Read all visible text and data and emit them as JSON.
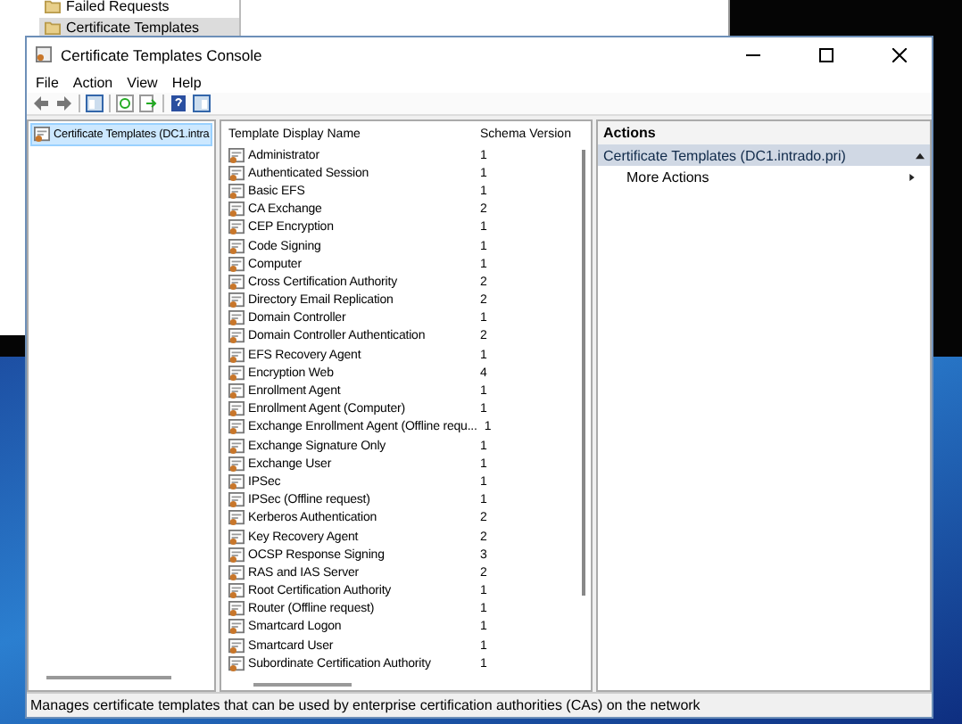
{
  "background_window": {
    "tree_items": [
      {
        "label": "Failed Requests",
        "selected": false
      },
      {
        "label": "Certificate Templates",
        "selected": true
      }
    ]
  },
  "window": {
    "title": "Certificate Templates Console"
  },
  "menu": [
    "File",
    "Action",
    "View",
    "Help"
  ],
  "tree": {
    "items": [
      {
        "label": "Certificate Templates (DC1.intra",
        "selected": true
      }
    ]
  },
  "table": {
    "columns": [
      "Template Display Name",
      "Schema Version"
    ],
    "rows": [
      {
        "name": "Administrator",
        "version": "1"
      },
      {
        "name": "Authenticated Session",
        "version": "1"
      },
      {
        "name": "Basic EFS",
        "version": "1"
      },
      {
        "name": "CA Exchange",
        "version": "2"
      },
      {
        "name": "CEP Encryption",
        "version": "1"
      },
      {
        "name": "Code Signing",
        "version": "1"
      },
      {
        "name": "Computer",
        "version": "1"
      },
      {
        "name": "Cross Certification Authority",
        "version": "2"
      },
      {
        "name": "Directory Email Replication",
        "version": "2"
      },
      {
        "name": "Domain Controller",
        "version": "1"
      },
      {
        "name": "Domain Controller Authentication",
        "version": "2"
      },
      {
        "name": "EFS Recovery Agent",
        "version": "1"
      },
      {
        "name": "Encryption Web",
        "version": "4"
      },
      {
        "name": "Enrollment Agent",
        "version": "1"
      },
      {
        "name": "Enrollment Agent (Computer)",
        "version": "1"
      },
      {
        "name": "Exchange Enrollment Agent (Offline requ...",
        "version": "1"
      },
      {
        "name": "Exchange Signature Only",
        "version": "1"
      },
      {
        "name": "Exchange User",
        "version": "1"
      },
      {
        "name": "IPSec",
        "version": "1"
      },
      {
        "name": "IPSec (Offline request)",
        "version": "1"
      },
      {
        "name": "Kerberos Authentication",
        "version": "2"
      },
      {
        "name": "Key Recovery Agent",
        "version": "2"
      },
      {
        "name": "OCSP Response Signing",
        "version": "3"
      },
      {
        "name": "RAS and IAS Server",
        "version": "2"
      },
      {
        "name": "Root Certification Authority",
        "version": "1"
      },
      {
        "name": "Router (Offline request)",
        "version": "1"
      },
      {
        "name": "Smartcard Logon",
        "version": "1"
      },
      {
        "name": "Smartcard User",
        "version": "1"
      },
      {
        "name": "Subordinate Certification Authority",
        "version": "1"
      }
    ]
  },
  "actions": {
    "heading": "Actions",
    "section": {
      "title": "Certificate Templates (DC1.intrado.pri)",
      "expanded": true
    },
    "items": [
      "More Actions"
    ]
  },
  "status_bar": "Manages certificate templates that can be used by enterprise certification authorities (CAs) on the network"
}
